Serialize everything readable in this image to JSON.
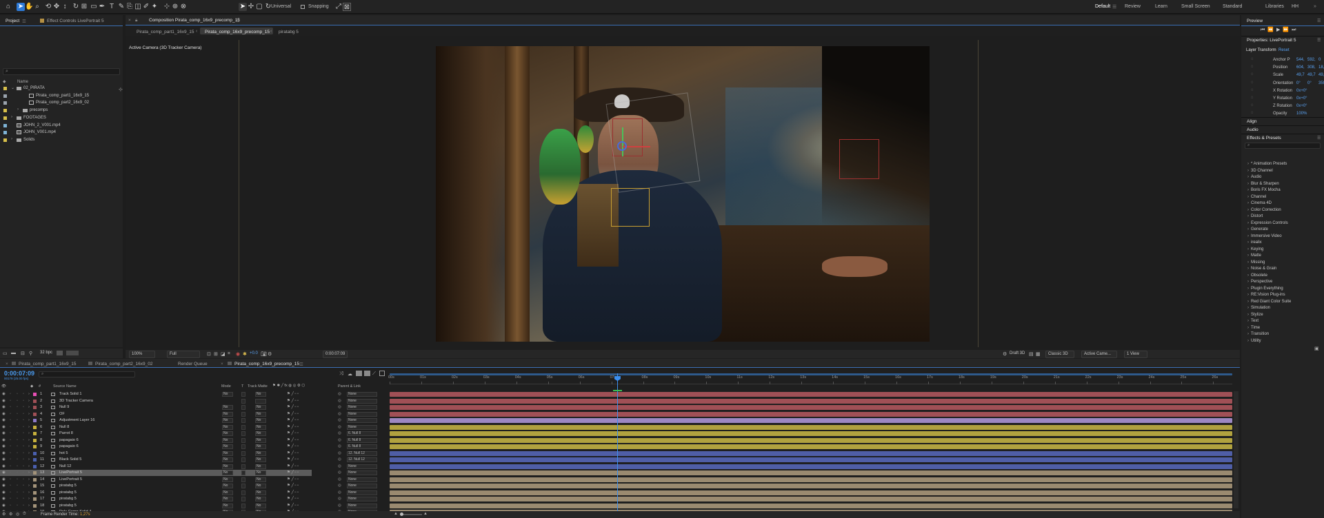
{
  "toolbar": {
    "universal": "Universal",
    "snapping": "Snapping",
    "workspaces": [
      "Default",
      "Review",
      "Learn",
      "Small Screen",
      "Standard",
      "Libraries",
      "HH"
    ]
  },
  "project": {
    "tabs": [
      "Project",
      "Effect Controls LivePortrait 5"
    ],
    "name_header": "Name",
    "items": [
      {
        "label": "02_PIRATA",
        "indent": 0,
        "color": "#d8c04a",
        "type": "folder",
        "open": true
      },
      {
        "label": "Pirata_comp_part1_16x9_15",
        "indent": 2,
        "color": "#9aa3ad",
        "type": "comp"
      },
      {
        "label": "Pirata_comp_part2_16x9_02",
        "indent": 2,
        "color": "#9aa3ad",
        "type": "comp"
      },
      {
        "label": "precomps",
        "indent": 1,
        "color": "#d8c04a",
        "type": "folder"
      },
      {
        "label": "FOOTAGES",
        "indent": 0,
        "color": "#d8c04a",
        "type": "folder"
      },
      {
        "label": "JOHN_2_V001.mp4",
        "indent": 0,
        "color": "#7eb3d6",
        "type": "file"
      },
      {
        "label": "JOHN_V001.mp4",
        "indent": 0,
        "color": "#7eb3d6",
        "type": "file"
      },
      {
        "label": "Solids",
        "indent": 0,
        "color": "#d8c04a",
        "type": "folder"
      }
    ],
    "bpc": "32 bpc"
  },
  "comp": {
    "panel_title": "Composition Pirata_comp_16x9_precomp_15",
    "tabs": [
      "Pirata_comp_part1_16x9_15",
      "Pirata_comp_16x9_precomp_15",
      "piratabg 5"
    ],
    "camera_label": "Active Camera (3D Tracker Camera)",
    "zoom": "100%",
    "resolution": "Full",
    "exposure": "+0.0",
    "timecode": "0:00:07:09",
    "renderer": "Draft 3D",
    "classic": "Classic 3D",
    "camera_select": "Active Came...",
    "views": "1 View"
  },
  "timeline": {
    "tabs": [
      "Pirata_comp_part1_16x9_15",
      "Pirata_comp_part2_16x9_02",
      "Render Queue",
      "Pirata_comp_16x9_precomp_15"
    ],
    "time": "0:00:07:09",
    "frames": "00179 (25.00 fps)",
    "headers": {
      "source": "Source Name",
      "mode": "Mode",
      "t": "T",
      "matte": "Track Matte",
      "parent": "Parent & Link"
    },
    "ruler": [
      "00s",
      "01s",
      "02s",
      "03s",
      "04s",
      "05s",
      "06s",
      "07s",
      "08s",
      "09s",
      "10s",
      "11s",
      "12s",
      "13s",
      "14s",
      "15s",
      "16s",
      "17s",
      "18s",
      "19s",
      "20s",
      "21s",
      "22s",
      "23s",
      "24s",
      "25s",
      "26s"
    ],
    "playhead_fraction": 0.27,
    "layers": [
      {
        "num": "1",
        "name": "Track Solid 1",
        "label": "#e84fb5",
        "bar": "#a05056",
        "mode": "No",
        "parent": "None"
      },
      {
        "num": "2",
        "name": "3D Tracker Camera",
        "label": "#a05056",
        "bar": "#a05056",
        "mode": "",
        "parent": "None"
      },
      {
        "num": "3",
        "name": "Null 9",
        "label": "#a05056",
        "bar": "#a05056",
        "mode": "No",
        "parent": "None"
      },
      {
        "num": "4",
        "name": "OF",
        "label": "#a05056",
        "bar": "#a05056",
        "mode": "No",
        "parent": "None"
      },
      {
        "num": "5",
        "name": "Adjustment Layer 16",
        "label": "#8c7ac8",
        "bar": "#9d88c2",
        "mode": "No",
        "parent": "None"
      },
      {
        "num": "6",
        "name": "Null 8",
        "label": "#c6b03c",
        "bar": "#b1a23f",
        "mode": "No",
        "parent": "None"
      },
      {
        "num": "7",
        "name": "Parrot 8",
        "label": "#c6b03c",
        "bar": "#b1a23f",
        "mode": "No",
        "parent": "6. Null 8"
      },
      {
        "num": "8",
        "name": "papagaio 6",
        "label": "#c6b03c",
        "bar": "#b1a23f",
        "mode": "No",
        "parent": "6. Null 8"
      },
      {
        "num": "9",
        "name": "papagaio 6",
        "label": "#c6b03c",
        "bar": "#b1a23f",
        "mode": "No",
        "parent": "6. Null 8"
      },
      {
        "num": "10",
        "name": "hot 5",
        "label": "#4a5fae",
        "bar": "#4f5ea6",
        "mode": "No",
        "parent": "12. Null 12"
      },
      {
        "num": "11",
        "name": "Black Solid 5",
        "label": "#4a5fae",
        "bar": "#4f5ea6",
        "mode": "No",
        "parent": "12. Null 12"
      },
      {
        "num": "12",
        "name": "Null 12",
        "label": "#4a5fae",
        "bar": "#4f5ea6",
        "mode": "No",
        "parent": "None"
      },
      {
        "num": "13",
        "name": "LivePortrait 5",
        "label": "#a3937a",
        "bar": "#9a8a70",
        "mode": "No",
        "parent": "None",
        "selected": true
      },
      {
        "num": "14",
        "name": "LivePortrait 5",
        "label": "#a3937a",
        "bar": "#9a8a70",
        "mode": "No",
        "parent": "None"
      },
      {
        "num": "15",
        "name": "piratabg 5",
        "label": "#a3937a",
        "bar": "#9a8a70",
        "mode": "No",
        "parent": "None"
      },
      {
        "num": "16",
        "name": "piratabg 5",
        "label": "#a3937a",
        "bar": "#9a8a70",
        "mode": "No",
        "parent": "None"
      },
      {
        "num": "17",
        "name": "piratabg 5",
        "label": "#a3937a",
        "bar": "#9a8a70",
        "mode": "No",
        "parent": "None"
      },
      {
        "num": "18",
        "name": "piratabg 5",
        "label": "#a3937a",
        "bar": "#9a8a70",
        "mode": "No",
        "parent": "None"
      },
      {
        "num": "19",
        "name": "Pole Comp Solid 4",
        "label": "#a3937a",
        "bar": "#9a8a70",
        "mode": "No",
        "parent": "None"
      }
    ],
    "render_time_label": "Frame Render Time:",
    "render_time": "1,27s"
  },
  "right": {
    "preview": "Preview",
    "properties": "Properties: LivePortrait 5",
    "layer_transform": "Layer Transform",
    "reset": "Reset",
    "props": [
      {
        "label": "Anchor P",
        "v": [
          "544,",
          "592,",
          "0"
        ]
      },
      {
        "label": "Position",
        "v": [
          "604,",
          "308,",
          "18,8"
        ]
      },
      {
        "label": "Scale",
        "v": [
          "49,7",
          "49,7",
          "49,7"
        ]
      },
      {
        "label": "Orientation",
        "v": [
          "0°",
          "0°",
          "359,"
        ]
      },
      {
        "label": "X Rotation",
        "v": [
          "0x+0°"
        ]
      },
      {
        "label": "Y Rotation",
        "v": [
          "0x+0°"
        ]
      },
      {
        "label": "Z Rotation",
        "v": [
          "0x+0°"
        ]
      },
      {
        "label": "Opacity",
        "v": [
          "100%"
        ]
      }
    ],
    "align": "Align",
    "audio": "Audio",
    "effects_title": "Effects & Presets",
    "effects": [
      "* Animation Presets",
      "3D Channel",
      "Audio",
      "Blur & Sharpen",
      "Boris FX Mocha",
      "Channel",
      "Cinema 4D",
      "Color Correction",
      "Distort",
      "Expression Controls",
      "Generate",
      "Immersive Video",
      "irealix",
      "Keying",
      "Matte",
      "Missing",
      "Noise & Grain",
      "Obsolete",
      "Perspective",
      "Plugin Everything",
      "RE:Vision Plug-ins",
      "Red Giant Color Suite",
      "Simulation",
      "Stylize",
      "Text",
      "Time",
      "Transition",
      "Utility"
    ]
  }
}
